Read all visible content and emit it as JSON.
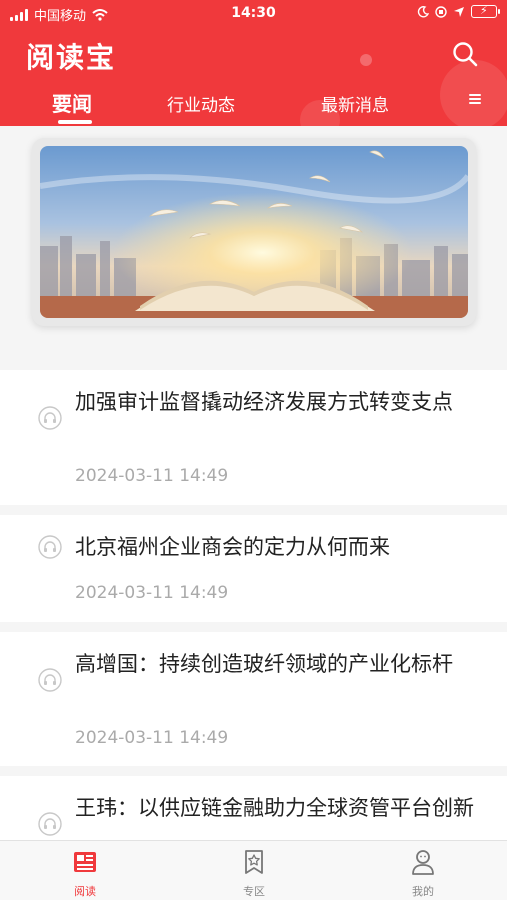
{
  "status_bar": {
    "carrier": "中国移动",
    "time": "14:30"
  },
  "header": {
    "app_title": "阅读宝",
    "search_icon": "search-icon",
    "background_color": "#f0393c"
  },
  "tabs": [
    {
      "label": "要闻",
      "active": true
    },
    {
      "label": "行业动态",
      "active": false
    },
    {
      "label": "最新消息",
      "active": false
    }
  ],
  "news": [
    {
      "title": "加强审计监督撬动经济发展方式转变支点",
      "date": "2024-03-11 14:49"
    },
    {
      "title": "北京福州企业商会的定力从何而来",
      "date": "2024-03-11 14:49"
    },
    {
      "title": "高增国：持续创造玻纤领域的产业化标杆",
      "date": "2024-03-11 14:49"
    },
    {
      "title": "王玮：以供应链金融助力全球资管平台创新",
      "date": ""
    }
  ],
  "bottom_nav": [
    {
      "label": "阅读",
      "icon": "newspaper-icon",
      "active": true
    },
    {
      "label": "专区",
      "icon": "bookmark-star-icon",
      "active": false
    },
    {
      "label": "我的",
      "icon": "user-icon",
      "active": false
    }
  ],
  "colors": {
    "accent": "#f0393c",
    "date_text": "#aaaaaa"
  }
}
